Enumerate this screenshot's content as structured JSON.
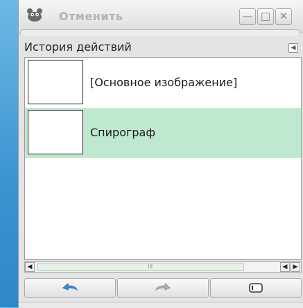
{
  "window": {
    "title": "Отменить",
    "controls": {
      "minimize": "—",
      "maximize": "□",
      "close": "✕"
    }
  },
  "panel": {
    "title": "История действий",
    "menu_icon": "triangle-left-icon"
  },
  "history": {
    "items": [
      {
        "label": "[Основное изображение]",
        "selected": false
      },
      {
        "label": "Спирограф",
        "selected": true
      }
    ],
    "selected_color": "#bfe9cf"
  },
  "scrollbar": {
    "left": "◀",
    "right_prev": "◀",
    "right_next": "▶",
    "grip": "III"
  },
  "actions": [
    {
      "name": "undo",
      "icon": "undo-icon"
    },
    {
      "name": "redo",
      "icon": "redo-icon"
    },
    {
      "name": "clear",
      "icon": "clear-history-icon"
    }
  ],
  "accent": "#3f8fd8"
}
